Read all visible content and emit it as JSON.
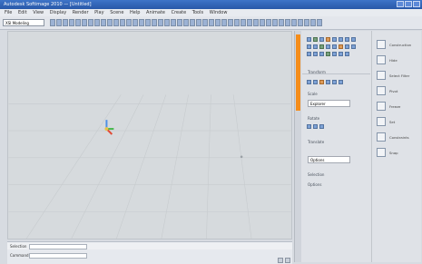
{
  "app": {
    "title": "Autodesk Softimage 2010 — [Untitled]",
    "menu": [
      "File",
      "Edit",
      "View",
      "Display",
      "Render",
      "Play",
      "Scene",
      "Help",
      "Animate",
      "Create",
      "Tools",
      "Window"
    ]
  },
  "toolbar": {
    "selector": "XSI Modeling",
    "icons": [
      "select",
      "move",
      "rotate",
      "scale",
      "snap",
      "render",
      "view",
      "camera",
      "light",
      "grid",
      "mesh",
      "curve",
      "poly",
      "sphere",
      "cube",
      "cone",
      "plane",
      "cylinder",
      "torus",
      "text",
      "null",
      "lattice",
      "deform",
      "particle",
      "physics",
      "hair",
      "cloth",
      "bones",
      "skin",
      "weight",
      "shape",
      "animate",
      "timeline",
      "keys",
      "curves",
      "dopesheet",
      "mixer",
      "script",
      "browser",
      "schematic",
      "explorer",
      "render-region",
      "viewports"
    ]
  },
  "panel": {
    "left": {
      "labels": [
        "Transform",
        "Scale",
        "Rotate",
        "Translate",
        "Selection",
        "Options"
      ],
      "fields": [
        "Explorer",
        "Options"
      ]
    },
    "right": {
      "tools": [
        "Construction",
        "Hide",
        "Select Filter",
        "Pivot",
        "Freeze",
        "Set",
        "Constraints",
        "Snap"
      ]
    }
  },
  "status": {
    "left_label": "Selection",
    "left_value": "",
    "right_label": "Command",
    "right_value": ""
  },
  "colors": {
    "accent": "#f58d1b",
    "viewport_bg": "#d6dadd",
    "panel_bg": "#dfe2e7",
    "titlebar": "#2f5eaf"
  }
}
